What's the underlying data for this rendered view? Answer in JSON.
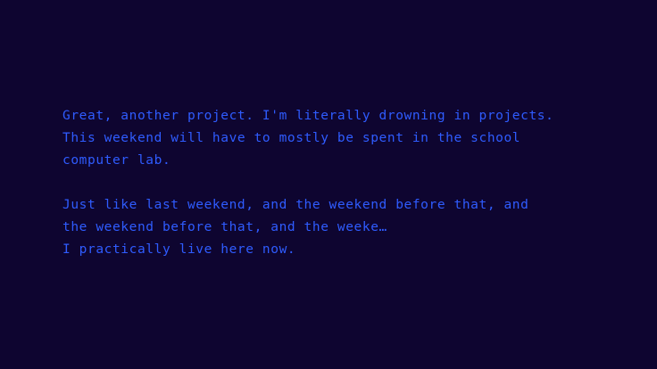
{
  "theme": {
    "background": "#0e0530",
    "text_color": "#2f5cff"
  },
  "dialogue": {
    "paragraphs": [
      {
        "lines": [
          "Great, another project. I'm literally drowning in projects.",
          "This weekend will have to mostly be spent in the school",
          "computer lab."
        ]
      },
      {
        "lines": [
          "Just like last weekend, and the weekend before that, and",
          "the weekend before that, and the weeke…",
          "I practically live here now."
        ]
      }
    ]
  }
}
